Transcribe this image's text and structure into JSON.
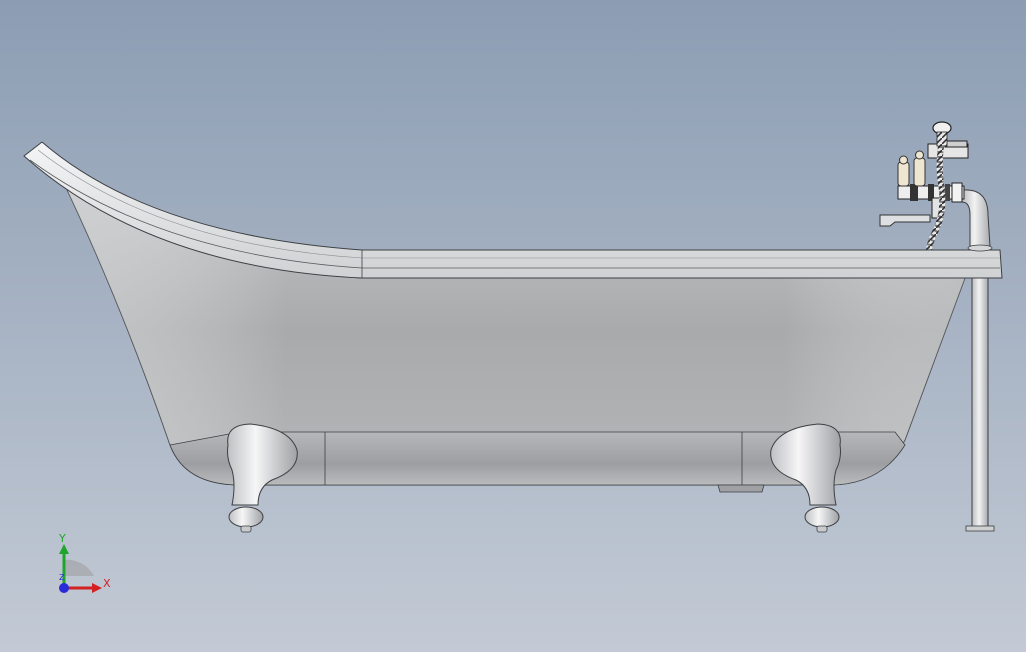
{
  "viewport": {
    "background_top": "#8c9db3",
    "background_bottom": "#c3cad5"
  },
  "model": {
    "body_color": "#a9abad",
    "rim_color": "#e4e5e7",
    "feet_color": "#d8d9db",
    "pipe_color": "#d3d4d6"
  },
  "triad": {
    "x_label": "X",
    "y_label": "Y",
    "z_label": "Z",
    "x_color": "#d32020",
    "y_color": "#1fa52e",
    "z_color": "#2a2ad8"
  }
}
